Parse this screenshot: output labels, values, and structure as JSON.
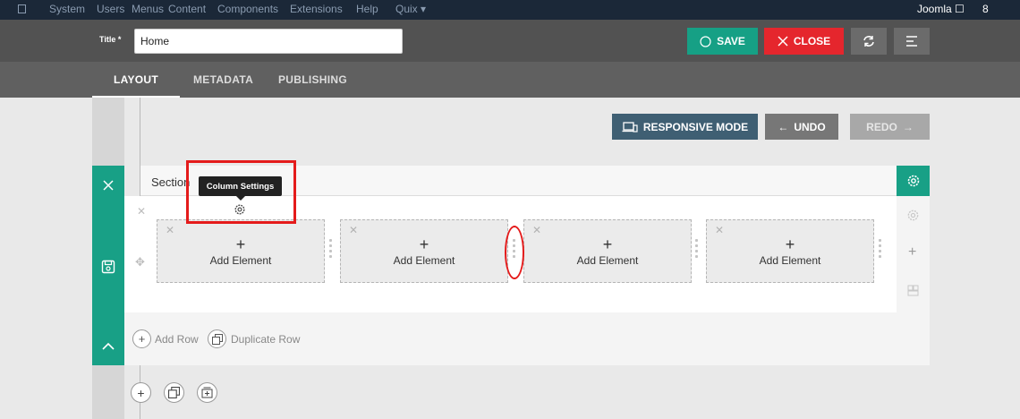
{
  "topbar": {
    "items": [
      "System",
      "Users",
      "Menus",
      "Content",
      "Components",
      "Extensions",
      "Help",
      "Quix ▾"
    ],
    "user": "Joomla",
    "counter": "8"
  },
  "titlebar": {
    "title_label": "Title *",
    "title_value": "Home",
    "save_label": "SAVE",
    "close_label": "CLOSE"
  },
  "tabs": [
    {
      "label": "LAYOUT",
      "active": true
    },
    {
      "label": "METADATA",
      "active": false
    },
    {
      "label": "PUBLISHING",
      "active": false
    }
  ],
  "toolbar": {
    "responsive_label": "RESPONSIVE MODE",
    "undo_label": "UNDO",
    "redo_label": "REDO"
  },
  "section": {
    "title": "Section",
    "tooltip": "Column Settings",
    "columns": [
      {
        "plus": "+",
        "label": "Add Element"
      },
      {
        "plus": "+",
        "label": "Add Element"
      },
      {
        "plus": "+",
        "label": "Add Element"
      },
      {
        "plus": "+",
        "label": "Add Element"
      }
    ],
    "add_row_label": "Add Row",
    "duplicate_row_label": "Duplicate Row"
  },
  "colors": {
    "accent": "#18a086",
    "close": "#e5262d",
    "annotation": "#e41b1b",
    "responsive": "#3f5f73"
  }
}
